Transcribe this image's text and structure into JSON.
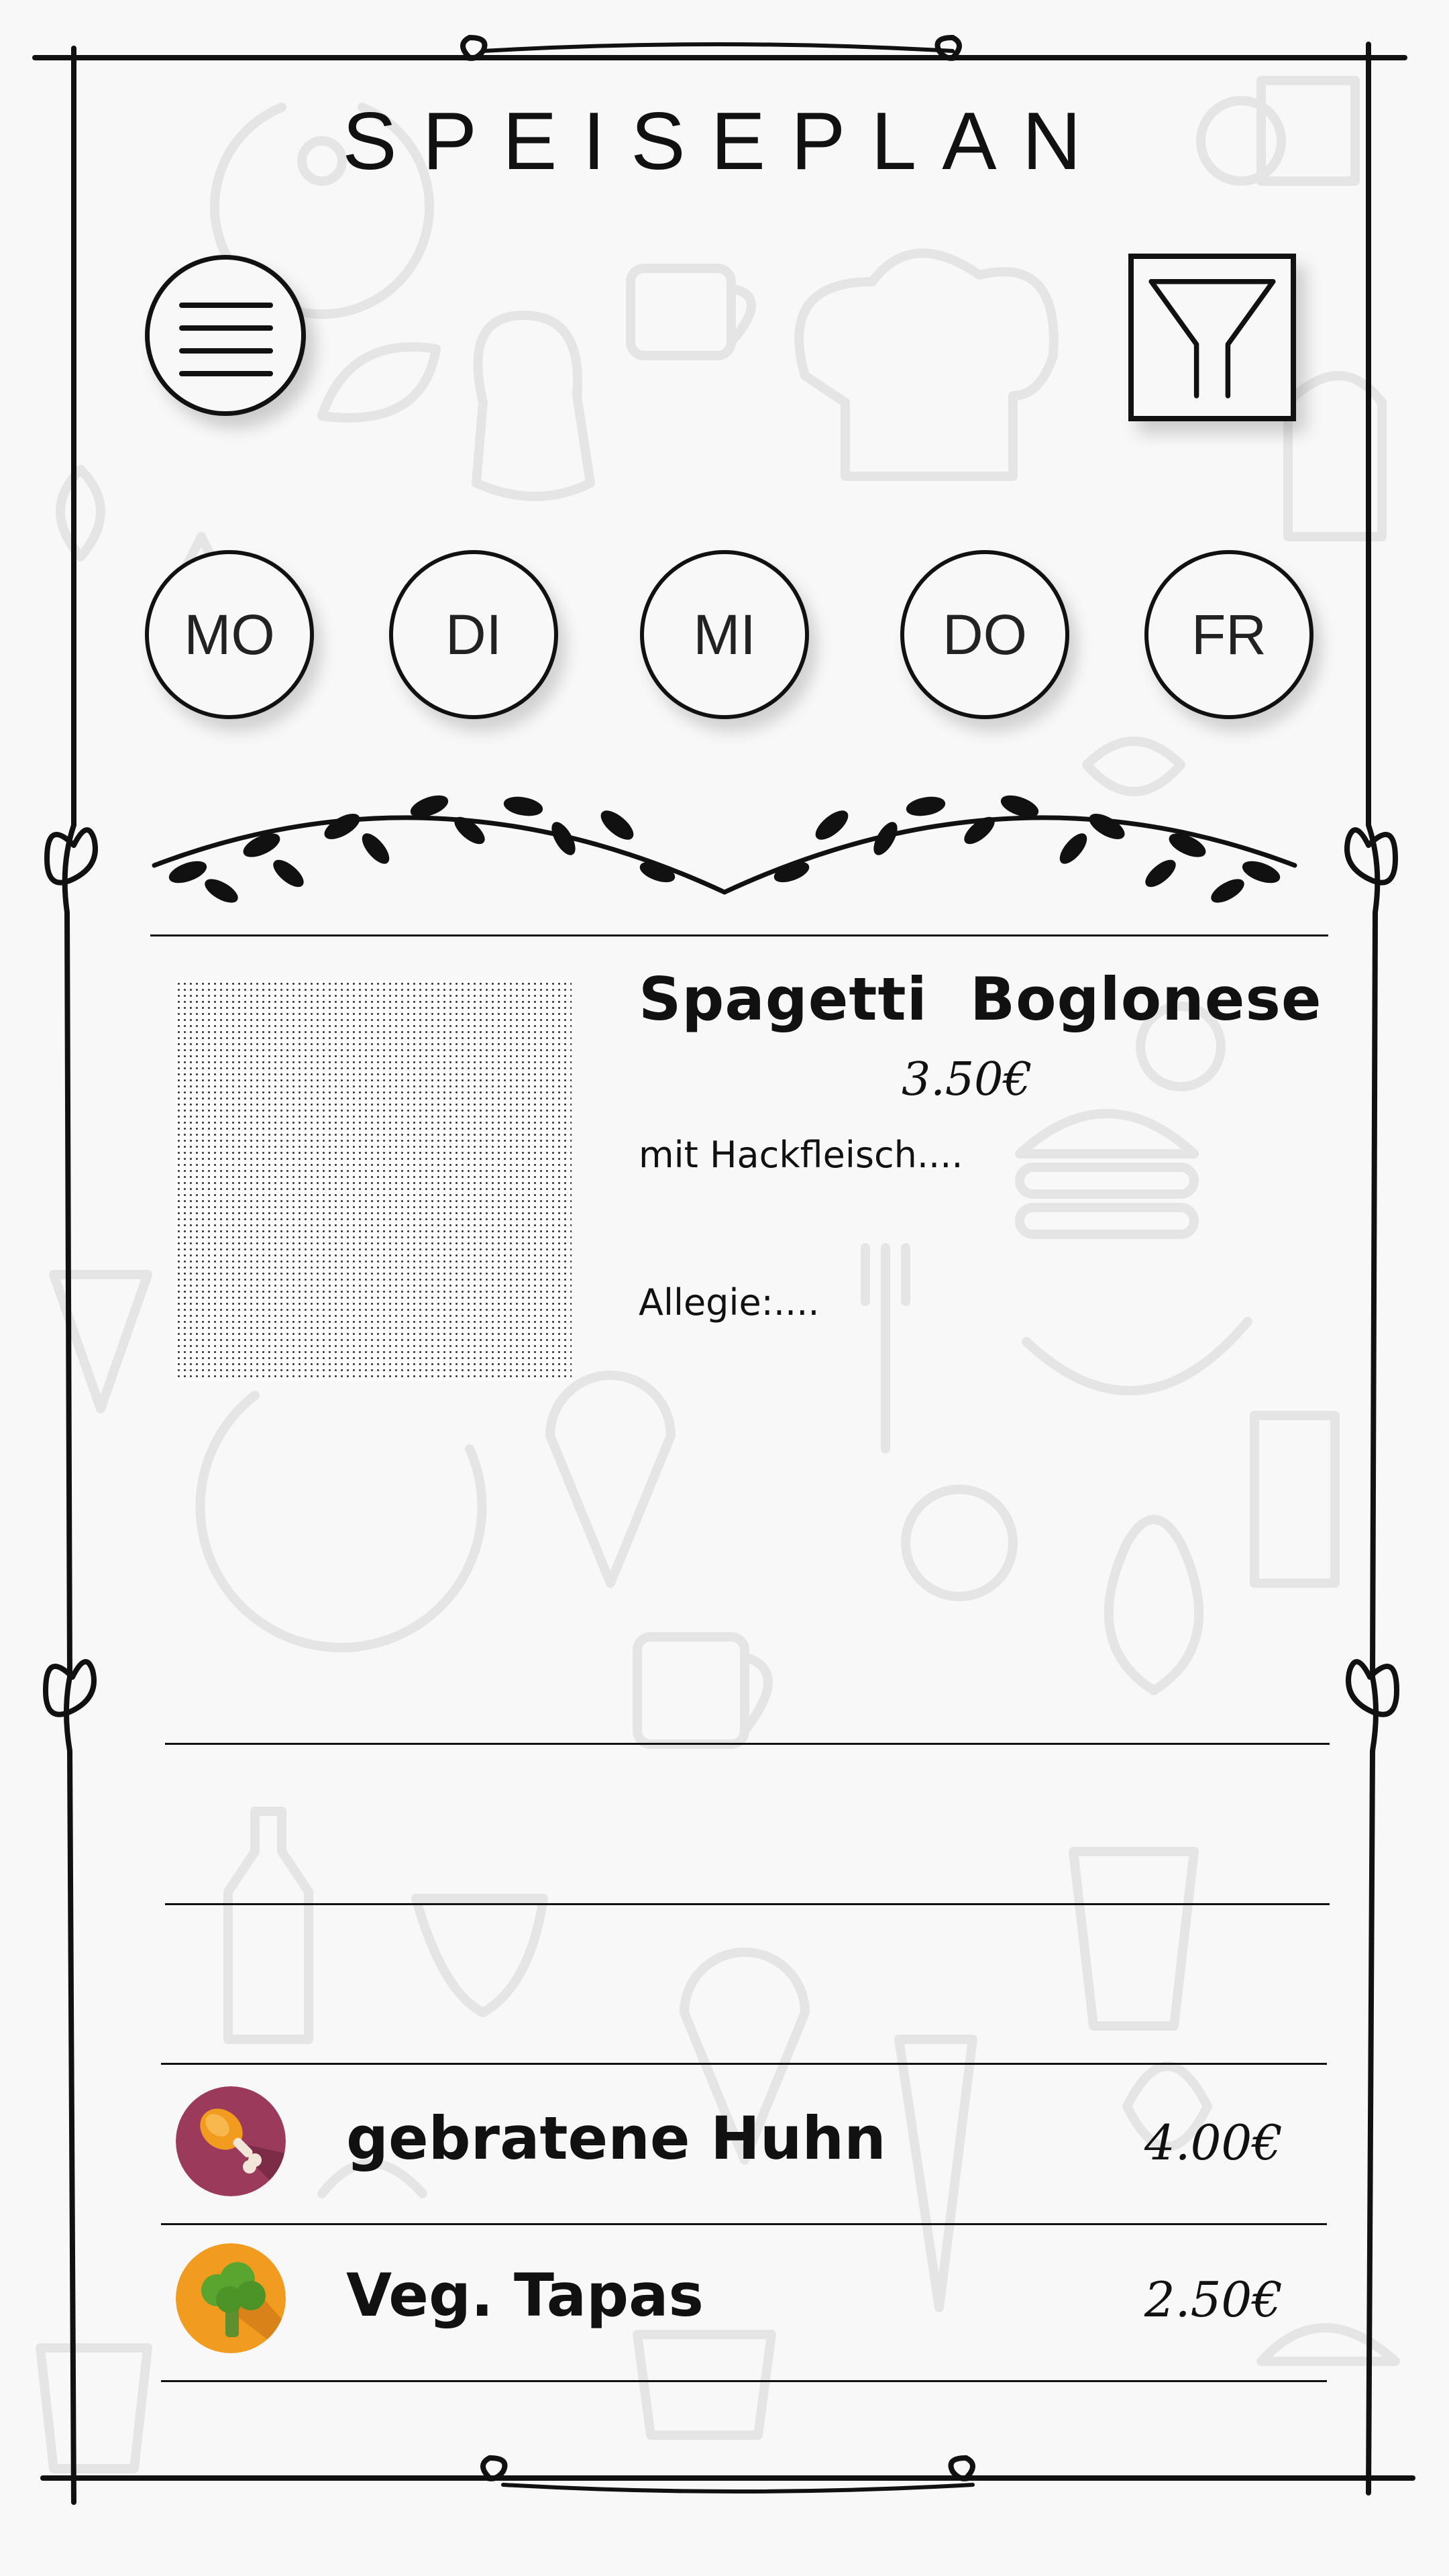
{
  "header": {
    "title": "SPEISEPLAN"
  },
  "toolbar": {
    "menu_icon": "hamburger-menu-icon",
    "filter_icon": "filter-funnel-icon"
  },
  "days": [
    {
      "label": "MO"
    },
    {
      "label": "DI"
    },
    {
      "label": "MI"
    },
    {
      "label": "DO"
    },
    {
      "label": "FR"
    }
  ],
  "featured": {
    "title": "Spagetti  Boglonese",
    "price": "3.50€",
    "description": "mit Hackfleisch....",
    "allergy": "Allegie:...."
  },
  "menu_items": [
    {
      "name": "gebratene Huhn",
      "price": "4.00€",
      "icon": "chicken-leg-icon",
      "icon_color": "#9b3a5a"
    },
    {
      "name": "Veg. Tapas",
      "price": "2.50€",
      "icon": "broccoli-icon",
      "icon_color": "#f29c1f"
    }
  ],
  "colors": {
    "line": "#111111",
    "background": "#f8f8f8",
    "doodle": "#e6e6e6"
  }
}
